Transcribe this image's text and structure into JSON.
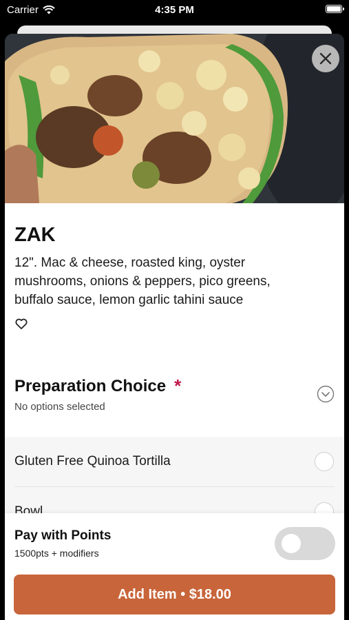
{
  "status_bar": {
    "carrier": "Carrier",
    "time": "4:35 PM"
  },
  "item": {
    "name": "ZAK",
    "description": "12\". Mac & cheese, roasted king, oyster mushrooms, onions & peppers, pico greens, buffalo sauce, lemon garlic tahini sauce",
    "image_icon": "food-photo"
  },
  "preparation": {
    "title": "Preparation Choice",
    "required_mark": "*",
    "subtitle": "No options selected",
    "options": [
      {
        "label": "Gluten Free Quinoa Tortilla"
      },
      {
        "label": "Bowl"
      }
    ]
  },
  "points": {
    "title": "Pay with Points",
    "subtitle": "1500pts + modifiers",
    "enabled": false
  },
  "add_button": {
    "label": "Add Item • $18.00"
  },
  "colors": {
    "accent": "#c8653a",
    "required": "#c01848"
  }
}
